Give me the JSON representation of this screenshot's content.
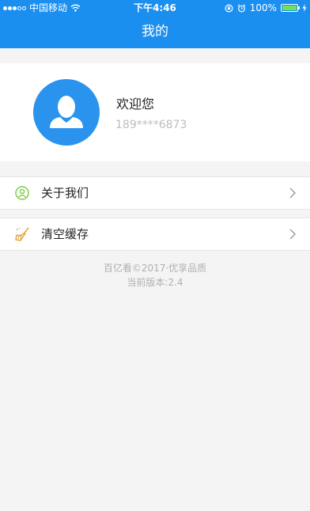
{
  "status_bar": {
    "carrier": "中国移动",
    "time": "下午4:46",
    "battery_text": "100%",
    "signal_dots_filled": 3,
    "signal_dots_total": 5,
    "battery_level": 1.0
  },
  "header": {
    "title": "我的"
  },
  "profile": {
    "welcome": "欢迎您",
    "phone": "189****6873",
    "avatar_icon": "user-silhouette-icon"
  },
  "menu": {
    "items": [
      {
        "label": "关于我们",
        "icon": "person-circle-icon"
      },
      {
        "label": "清空缓存",
        "icon": "broom-icon"
      }
    ]
  },
  "footer": {
    "copyright": "百亿看©2017·优享品质",
    "version": "当前版本:2.4"
  },
  "colors": {
    "primary": "#1b8ff0",
    "avatar_bg": "#2a93ee",
    "page_bg": "#f4f4f4",
    "icon_green": "#7fcc4a",
    "icon_orange": "#e7a13a",
    "muted_text": "#b0b0b0"
  }
}
